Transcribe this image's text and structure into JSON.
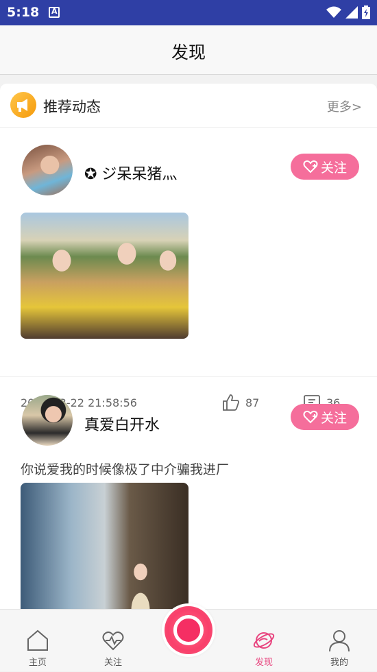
{
  "status": {
    "time": "5:18"
  },
  "header": {
    "title": "发现"
  },
  "section": {
    "title": "推荐动态",
    "more": "更多>"
  },
  "posts": [
    {
      "username": "✪ ジ呆呆猪灬",
      "follow_label": "关注",
      "date": "2025-03-22 21:58:56",
      "likes": "87",
      "comments": "36"
    },
    {
      "username": "真爱白开水",
      "follow_label": "关注",
      "caption": "你说爱我的时候像极了中介骗我进厂"
    }
  ],
  "tabs": [
    {
      "label": "主页",
      "icon": "home-icon"
    },
    {
      "label": "关注",
      "icon": "heart-pulse-icon"
    },
    {
      "label": "发现",
      "icon": "planet-icon"
    },
    {
      "label": "我的",
      "icon": "person-icon"
    }
  ],
  "colors": {
    "statusbar": "#2f3fa5",
    "accent": "#f56e9b",
    "active_tab": "#e8457f"
  }
}
